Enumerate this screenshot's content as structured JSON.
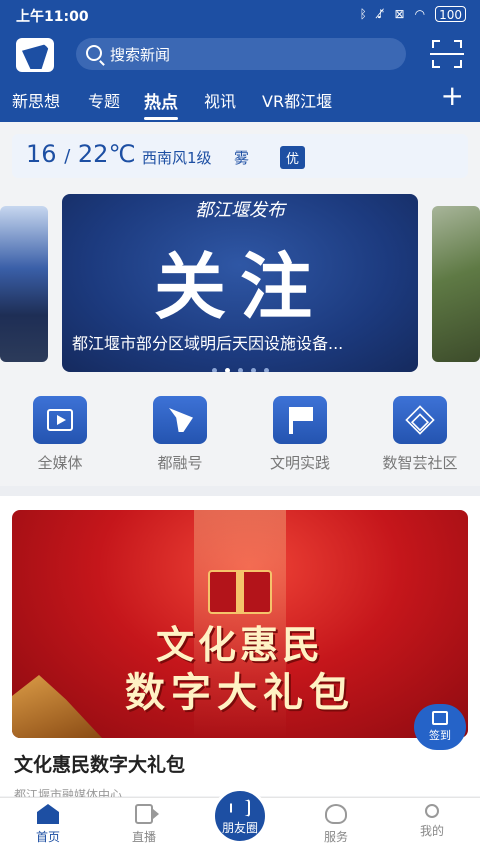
{
  "status": {
    "time": "上午11:00",
    "battery": "100",
    "icons": [
      "bluetooth-icon",
      "mute-icon",
      "no-sim-icon",
      "wifi-icon",
      "battery-icon"
    ]
  },
  "header": {
    "search_placeholder": "搜索新闻",
    "tabs": [
      "新思想",
      "专题",
      "热点",
      "视讯",
      "VR都江堰"
    ],
    "active_tab": "热点",
    "accent": "#1d4fa3"
  },
  "weather": {
    "low": "16",
    "separator": "/",
    "high": "22℃",
    "wind": "西南风1级",
    "condition": "雾",
    "aqi": "优"
  },
  "carousel": {
    "brand": "都江堰发布",
    "headline": "关注",
    "caption": "都江堰市部分区域明后天因设施设备...",
    "slide_count": 5,
    "active_index": 1
  },
  "quick_entries": [
    {
      "label": "全媒体",
      "icon": "film-icon"
    },
    {
      "label": "都融号",
      "icon": "wing-icon"
    },
    {
      "label": "文明实践",
      "icon": "flag-icon"
    },
    {
      "label": "数智芸社区",
      "icon": "cube-icon"
    }
  ],
  "feature": {
    "image_line1": "文化惠民",
    "image_line2": "数字大礼包",
    "title": "文化惠民数字大礼包",
    "source": "都江堰市融媒体中心",
    "signin_label": "签到"
  },
  "bottom_nav": {
    "home": "首页",
    "live": "直播",
    "center": "朋友圈",
    "service": "服务",
    "me": "我的"
  }
}
